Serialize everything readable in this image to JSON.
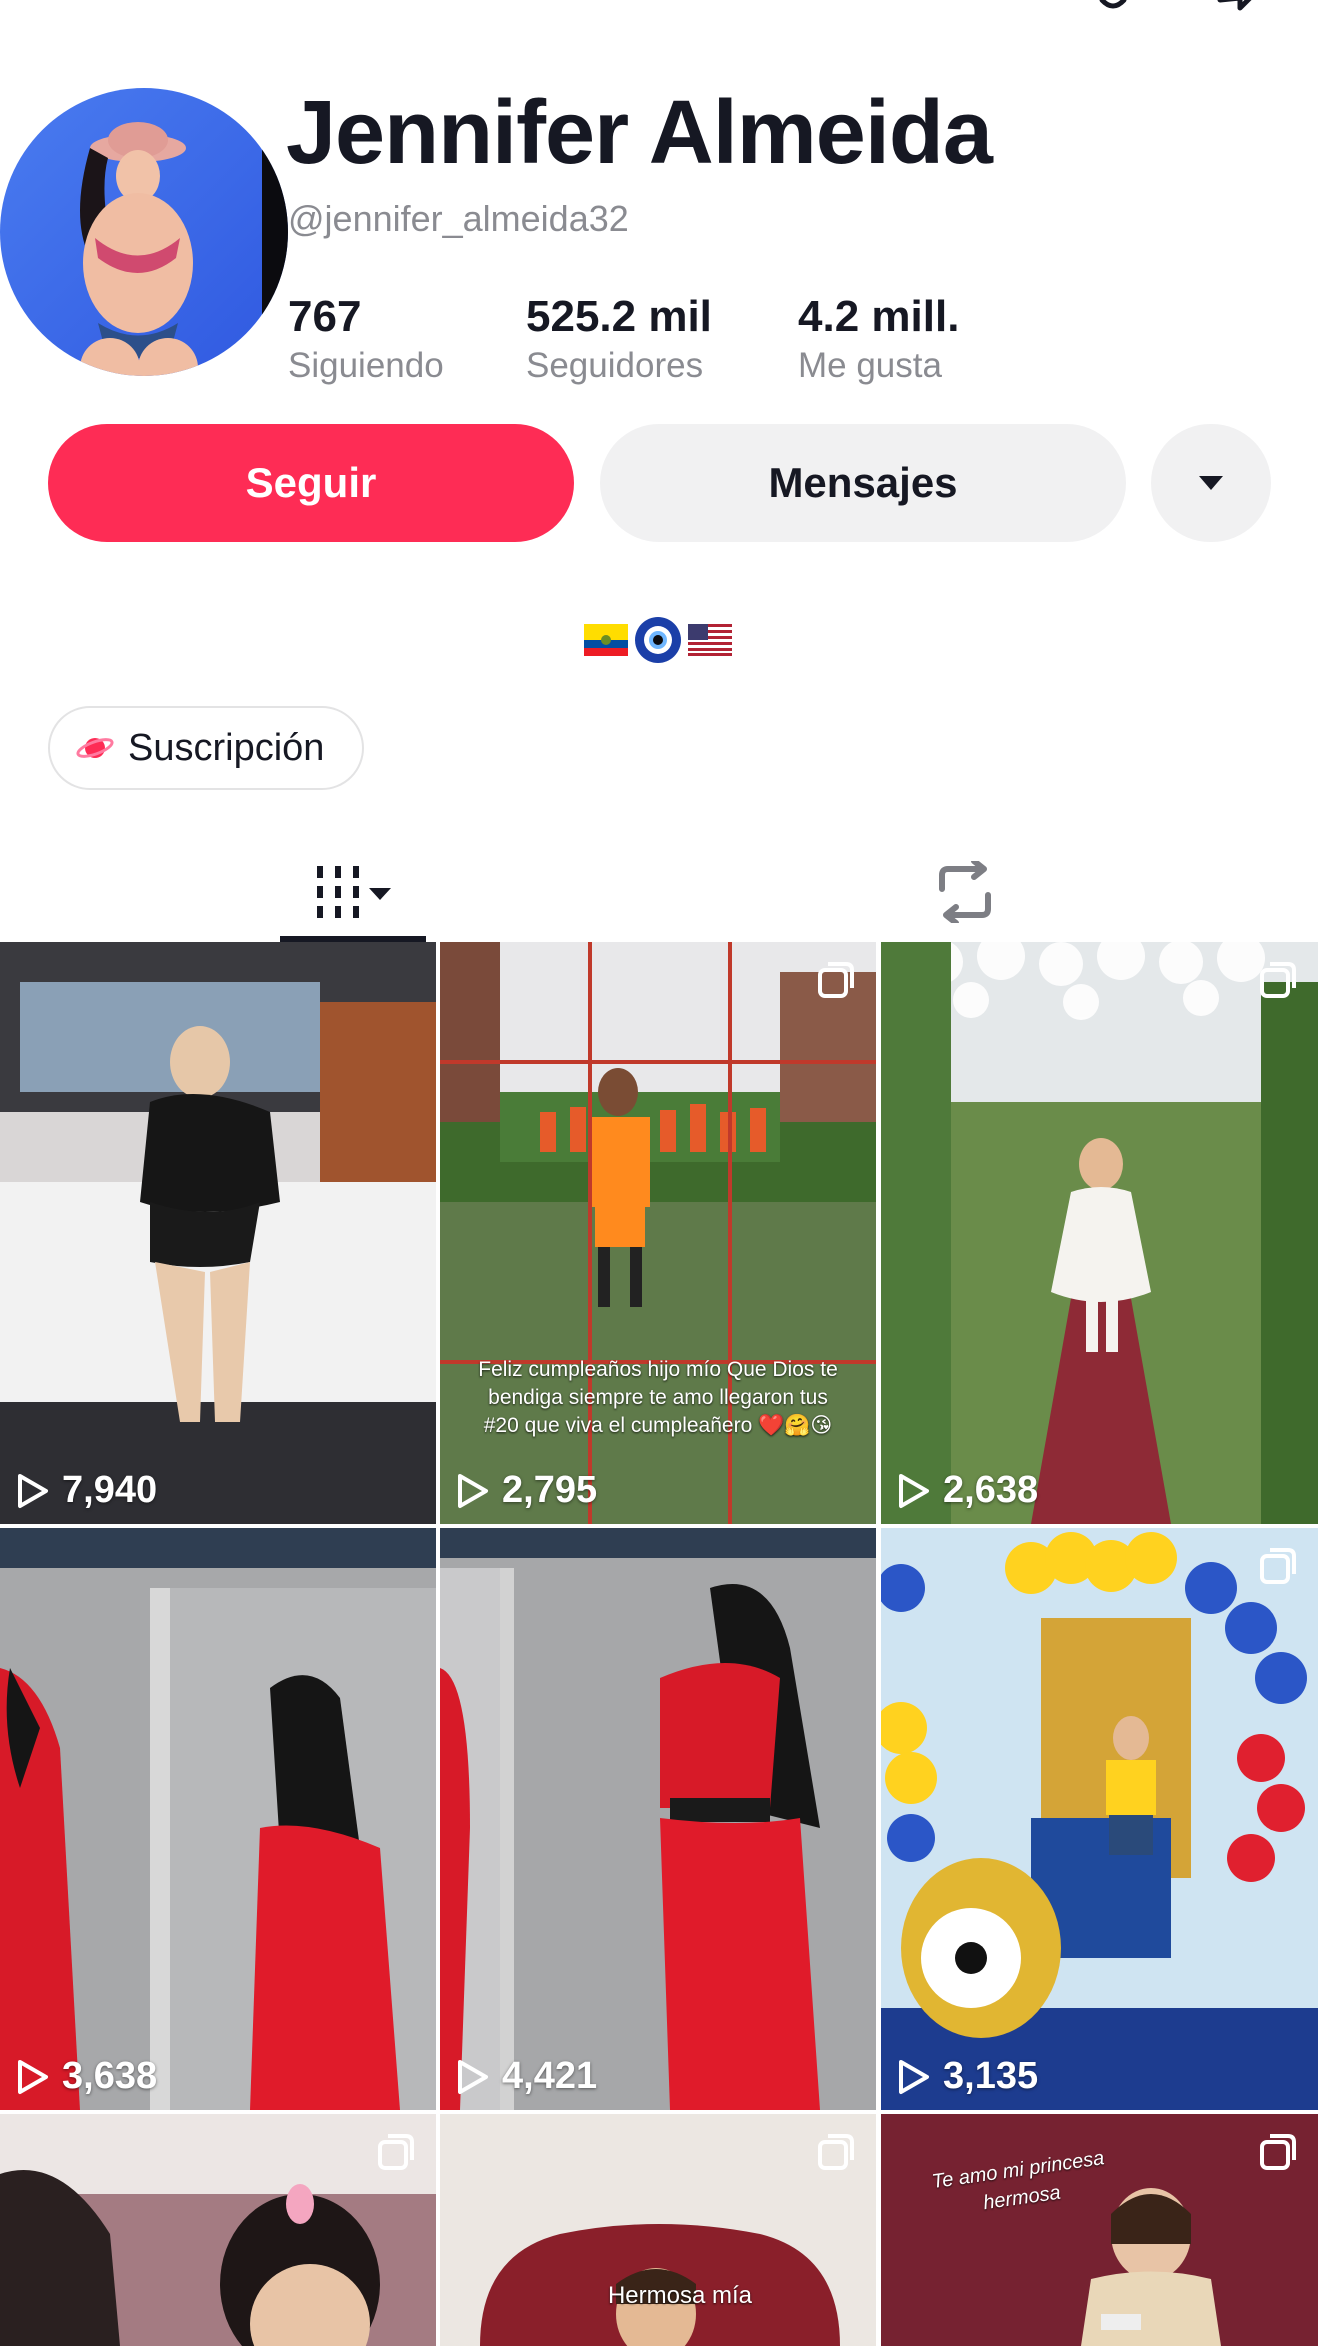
{
  "profile": {
    "name": "Jennifer Almeida",
    "handle": "@jennifer_almeida32"
  },
  "stats": {
    "following": {
      "value": "767",
      "label": "Siguiendo"
    },
    "followers": {
      "value": "525.2 mil",
      "label": "Seguidores"
    },
    "likes": {
      "value": "4.2 mill.",
      "label": "Me gusta"
    }
  },
  "actions": {
    "follow_label": "Seguir",
    "message_label": "Mensajes"
  },
  "bio": {
    "emojis": [
      "ecuador-flag-icon",
      "nazar-amulet-icon",
      "usa-flag-icon"
    ]
  },
  "subscription": {
    "label": "Suscripción"
  },
  "tabs": {
    "videos_icon": "grid-columns-icon",
    "reposts_icon": "repost-icon",
    "active": "videos"
  },
  "videos": [
    {
      "views": "7,940",
      "multi": false
    },
    {
      "views": "2,795",
      "multi": true,
      "caption": "Feliz cumpleaños hijo mío Que Dios te bendiga siempre te amo llegaron tus #20 que viva el cumpleañero ❤️🤗😘"
    },
    {
      "views": "2,638",
      "multi": true
    },
    {
      "views": "3,638",
      "multi": false
    },
    {
      "views": "4,421",
      "multi": false
    },
    {
      "views": "3,135",
      "multi": true
    },
    {
      "views": "",
      "multi": true
    },
    {
      "views": "",
      "multi": true,
      "caption": "Hermosa mía"
    },
    {
      "views": "",
      "multi": true,
      "caption": "Te amo mi princesa hermosa"
    }
  ],
  "colors": {
    "follow_button": "#fe2c55",
    "secondary_button": "#f1f1f2",
    "muted_text": "#8a8b91",
    "primary_text": "#161823"
  }
}
